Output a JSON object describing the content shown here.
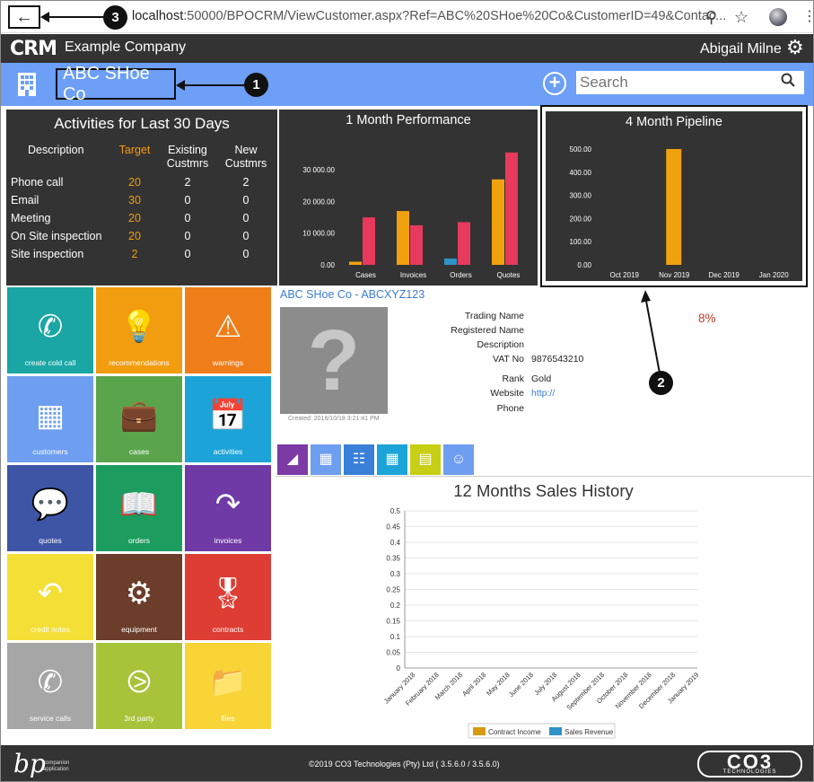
{
  "browser": {
    "url_host": "localhost",
    "url_rest": ":50000/BPOCRM/ViewCustomer.aspx?Ref=ABC%20SHoe%20Co&CustomerID=49&Contac...",
    "zoom_icon": "zoom-icon",
    "star_icon": "star-icon"
  },
  "callouts": {
    "c1": "1",
    "c2": "2",
    "c3": "3"
  },
  "header": {
    "logo": "CRM",
    "company": "Example Company",
    "user": "Abigail Milne"
  },
  "customer_bar": {
    "title": "ABC SHoe Co",
    "search_placeholder": "Search"
  },
  "activities": {
    "title": "Activities for Last 30 Days",
    "columns": [
      "Description",
      "Target",
      "Existing Custmrs",
      "New Custmrs"
    ],
    "rows": [
      {
        "desc": "Phone call",
        "target": "20",
        "existing": "2",
        "new": "2"
      },
      {
        "desc": "Email",
        "target": "30",
        "existing": "0",
        "new": "0"
      },
      {
        "desc": "Meeting",
        "target": "20",
        "existing": "0",
        "new": "0"
      },
      {
        "desc": "On Site inspection",
        "target": "20",
        "existing": "0",
        "new": "0"
      },
      {
        "desc": "Site inspection",
        "target": "2",
        "existing": "0",
        "new": "0"
      }
    ]
  },
  "tiles": [
    {
      "label": "create cold call",
      "color": "#1aa6a4",
      "icon": "phone-icon"
    },
    {
      "label": "recommendations",
      "color": "#f29c0f",
      "icon": "lightbulb-icon"
    },
    {
      "label": "warnings",
      "color": "#ef7d1a",
      "icon": "warning-icon"
    },
    {
      "label": "customers",
      "color": "#6e9ef0",
      "icon": "building-icon"
    },
    {
      "label": "cases",
      "color": "#5aa54c",
      "icon": "briefcase-icon"
    },
    {
      "label": "activities",
      "color": "#1ca4d8",
      "icon": "calendar-icon"
    },
    {
      "label": "quotes",
      "color": "#3e55a5",
      "icon": "chat-icon"
    },
    {
      "label": "orders",
      "color": "#1c9c5e",
      "icon": "book-icon"
    },
    {
      "label": "invoices",
      "color": "#6f3aa6",
      "icon": "redo-arrow-icon"
    },
    {
      "label": "credit notes",
      "color": "#f3df35",
      "icon": "undo-arrow-icon"
    },
    {
      "label": "equipment",
      "color": "#6b3d2a",
      "icon": "gears-icon"
    },
    {
      "label": "contracts",
      "color": "#dd3d33",
      "icon": "award-icon"
    },
    {
      "label": "service calls",
      "color": "#a6a6a6",
      "icon": "phone-icon"
    },
    {
      "label": "3rd party",
      "color": "#a6c33a",
      "icon": "share-icon"
    },
    {
      "label": "files",
      "color": "#f8d436",
      "icon": "folder-icon"
    }
  ],
  "customer": {
    "link": "ABC SHoe Co - ABCXYZ123",
    "created": "Created: 2016/10/18 3:21:41 PM",
    "percent": "8%",
    "fields": [
      {
        "label": "Trading Name",
        "value": ""
      },
      {
        "label": "Registered Name",
        "value": ""
      },
      {
        "label": "Description",
        "value": ""
      },
      {
        "label": "VAT No",
        "value": "9876543210"
      },
      {
        "label": "Rank",
        "value": "Gold"
      },
      {
        "label": "Website",
        "value": "http://"
      },
      {
        "label": "Phone",
        "value": ""
      }
    ]
  },
  "tabs": [
    {
      "icon": "area-chart-icon",
      "color": "#7b3aa6"
    },
    {
      "icon": "building-icon",
      "color": "#6e9ef0"
    },
    {
      "icon": "contacts-book-icon",
      "color": "#3a80d8"
    },
    {
      "icon": "calendar-icon",
      "color": "#1ca4d8"
    },
    {
      "icon": "document-icon",
      "color": "#c6cf14"
    },
    {
      "icon": "users-icon",
      "color": "#6e9ef0"
    }
  ],
  "footer": {
    "bp_logo": "bp",
    "bp_sub1": "companion",
    "bp_sub2": "application",
    "copyright": "©2019 CO3 Technologies (Pty) Ltd ( 3.5.6.0 / 3.5.6.0)",
    "co3_logo": "CO3",
    "co3_sub": "TECHNOLOGIES"
  },
  "chart_data": [
    {
      "type": "bar",
      "title": "1 Month Performance",
      "categories": [
        "Cases",
        "Invoices",
        "Orders",
        "Quotes"
      ],
      "series": [
        {
          "name": "",
          "color": "#f0a20e",
          "values": [
            1000,
            17000,
            0,
            27000
          ]
        },
        {
          "name": "",
          "color": "#2e93c6",
          "values": [
            0,
            0,
            2000,
            0
          ]
        },
        {
          "name": "",
          "color": "#e73a5d",
          "values": [
            15000,
            12500,
            13500,
            35500
          ]
        }
      ],
      "yticks": [
        "0.00",
        "10 000.00",
        "20 000.00",
        "30 000.00"
      ],
      "ylim": [
        0,
        38000
      ]
    },
    {
      "type": "bar",
      "title": "4 Month Pipeline",
      "categories": [
        "Oct 2019",
        "Nov 2019",
        "Dec 2019",
        "Jan 2020"
      ],
      "values": [
        0,
        500,
        0,
        0
      ],
      "color": "#f0a20e",
      "yticks": [
        "0.00",
        "100.00",
        "200.00",
        "300.00",
        "400.00",
        "500.00"
      ],
      "ylim": [
        0,
        540
      ]
    },
    {
      "type": "bar",
      "title": "12 Months Sales History",
      "categories": [
        "January 2018",
        "February 2018",
        "March 2018",
        "April 2018",
        "May 2018",
        "June 2018",
        "July 2018",
        "August 2018",
        "September 2018",
        "October 2018",
        "November 2018",
        "December 2018",
        "January 2019"
      ],
      "series": [
        {
          "name": "Contract Income",
          "color": "#d89a10",
          "values": [
            0,
            0,
            0,
            0,
            0,
            0,
            0,
            0,
            0,
            0,
            0,
            0,
            0
          ]
        },
        {
          "name": "Sales Revenue",
          "color": "#2e93c6",
          "values": [
            0,
            0,
            0,
            0,
            0,
            0,
            0,
            0,
            0,
            0,
            0,
            0,
            0
          ]
        }
      ],
      "yticks": [
        "0",
        "0.05",
        "0.1",
        "0.15",
        "0.2",
        "0.25",
        "0.3",
        "0.35",
        "0.4",
        "0.45",
        "0.5"
      ],
      "ylim": [
        0,
        0.5
      ],
      "legend": "bottom"
    }
  ]
}
